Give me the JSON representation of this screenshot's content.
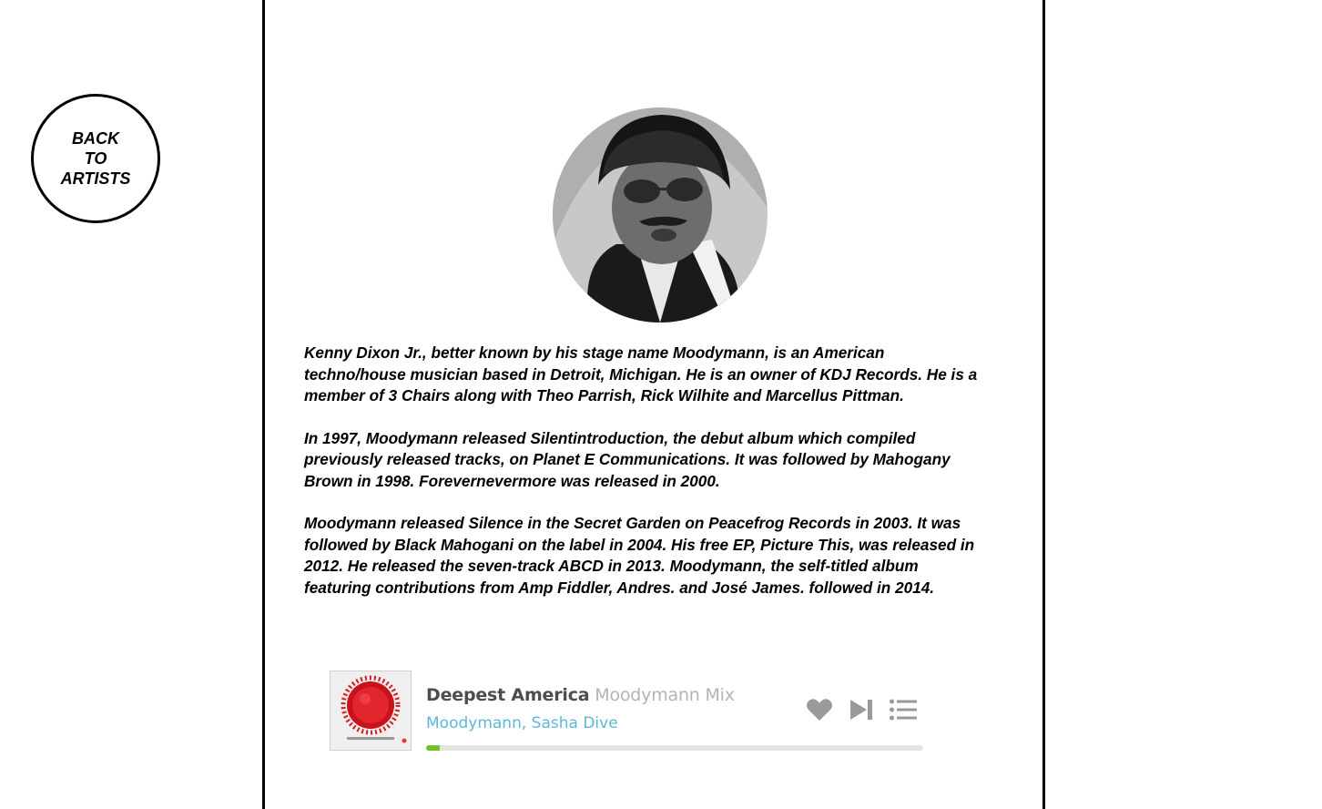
{
  "nav": {
    "back_label": "BACK TO ARTISTS"
  },
  "artist": {
    "bio": [
      "Kenny Dixon Jr., better known by his stage name Moodymann, is an American techno/house musician based in Detroit, Michigan. He is an owner of KDJ Records. He is a member of 3 Chairs along with Theo Parrish, Rick Wilhite and Marcellus Pittman.",
      "In 1997, Moodymann released Silentintroduction, the debut album which compiled previously released tracks, on Planet E Communications. It was followed by Mahogany Brown in 1998. Forevernevermore was released in 2000.",
      "Moodymann released Silence in the Secret Garden on Peacefrog Records in 2003. It was followed by Black Mahogani on the label in 2004. His free EP, Picture This, was released in 2012. He released the seven-track ABCD in 2013. Moodymann, the self-titled album featuring contributions from Amp Fiddler, Andres. and José James. followed in 2014."
    ]
  },
  "player": {
    "track_name": "Deepest America",
    "track_mix": "Moodymann Mix",
    "artists": "Moodymann, Sasha Dive",
    "progress": 0.027,
    "icons": [
      "heart-icon",
      "skip-next-icon",
      "playlist-icon"
    ],
    "colors": {
      "artists": "#5bb8d6",
      "progress": "#74c02a",
      "icons": "#9a9a9a"
    }
  }
}
